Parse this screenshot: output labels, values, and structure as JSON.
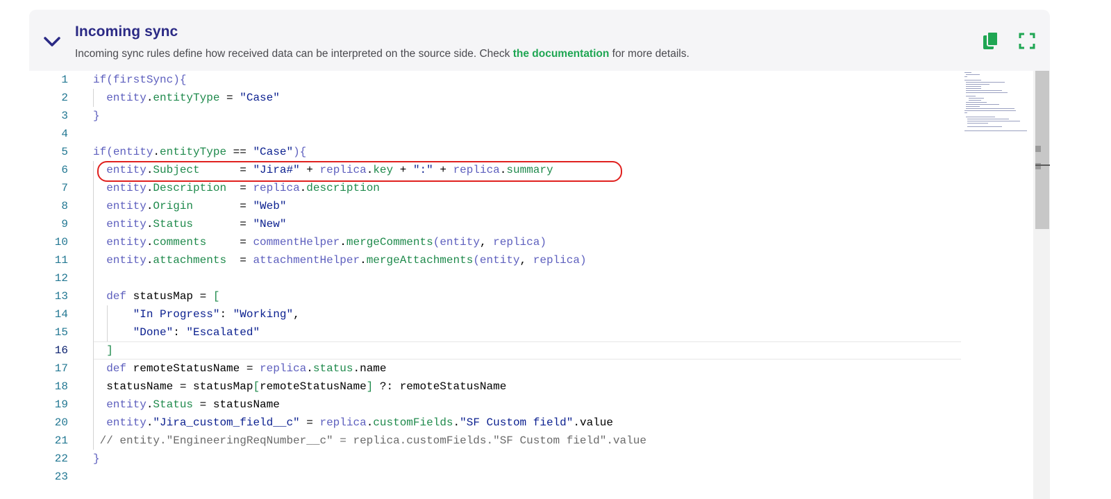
{
  "panel": {
    "title": "Incoming sync",
    "description_before": "Incoming sync rules define how received data can be interpreted on the source side. Check ",
    "doc_link": "the documentation",
    "description_after": " for more details.",
    "collapse_icon": "chevron-down-icon",
    "copy_icon": "copy-icon",
    "fullscreen_icon": "fullscreen-icon",
    "accent_color": "#1fa653",
    "title_color": "#2b2a85"
  },
  "editor": {
    "active_line": 16,
    "highlighted_line": 6,
    "highlight_color": "#e0211f",
    "lines": [
      {
        "n": "1",
        "code": "if(firstSync){"
      },
      {
        "n": "2",
        "code": "  entity.entityType = \"Case\""
      },
      {
        "n": "3",
        "code": "}"
      },
      {
        "n": "4",
        "code": ""
      },
      {
        "n": "5",
        "code": "if(entity.entityType == \"Case\"){"
      },
      {
        "n": "6",
        "code": "  entity.Subject      = \"Jira#\" + replica.key + \":\" + replica.summary"
      },
      {
        "n": "7",
        "code": "  entity.Description  = replica.description"
      },
      {
        "n": "8",
        "code": "  entity.Origin       = \"Web\""
      },
      {
        "n": "9",
        "code": "  entity.Status       = \"New\""
      },
      {
        "n": "10",
        "code": "  entity.comments     = commentHelper.mergeComments(entity, replica)"
      },
      {
        "n": "11",
        "code": "  entity.attachments  = attachmentHelper.mergeAttachments(entity, replica)"
      },
      {
        "n": "12",
        "code": ""
      },
      {
        "n": "13",
        "code": "  def statusMap = ["
      },
      {
        "n": "14",
        "code": "      \"In Progress\": \"Working\","
      },
      {
        "n": "15",
        "code": "      \"Done\": \"Escalated\""
      },
      {
        "n": "16",
        "code": "  ]"
      },
      {
        "n": "17",
        "code": "  def remoteStatusName = replica.status.name"
      },
      {
        "n": "18",
        "code": "  statusName = statusMap[remoteStatusName] ?: remoteStatusName"
      },
      {
        "n": "19",
        "code": "  entity.Status = statusName"
      },
      {
        "n": "20",
        "code": "  entity.\"Jira_custom_field__c\" = replica.customFields.\"SF Custom field\".value"
      },
      {
        "n": "21",
        "code": " // entity.\"EngineeringReqNumber__c\" = replica.customFields.\"SF Custom field\".value"
      },
      {
        "n": "22",
        "code": "}"
      },
      {
        "n": "23",
        "code": ""
      }
    ]
  }
}
